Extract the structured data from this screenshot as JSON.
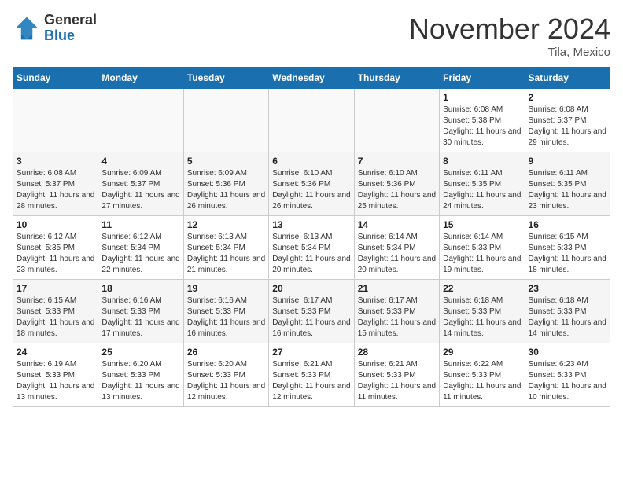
{
  "header": {
    "logo_general": "General",
    "logo_blue": "Blue",
    "month_title": "November 2024",
    "location": "Tila, Mexico"
  },
  "weekdays": [
    "Sunday",
    "Monday",
    "Tuesday",
    "Wednesday",
    "Thursday",
    "Friday",
    "Saturday"
  ],
  "weeks": [
    [
      {
        "day": "",
        "info": ""
      },
      {
        "day": "",
        "info": ""
      },
      {
        "day": "",
        "info": ""
      },
      {
        "day": "",
        "info": ""
      },
      {
        "day": "",
        "info": ""
      },
      {
        "day": "1",
        "info": "Sunrise: 6:08 AM\nSunset: 5:38 PM\nDaylight: 11 hours and 30 minutes."
      },
      {
        "day": "2",
        "info": "Sunrise: 6:08 AM\nSunset: 5:37 PM\nDaylight: 11 hours and 29 minutes."
      }
    ],
    [
      {
        "day": "3",
        "info": "Sunrise: 6:08 AM\nSunset: 5:37 PM\nDaylight: 11 hours and 28 minutes."
      },
      {
        "day": "4",
        "info": "Sunrise: 6:09 AM\nSunset: 5:37 PM\nDaylight: 11 hours and 27 minutes."
      },
      {
        "day": "5",
        "info": "Sunrise: 6:09 AM\nSunset: 5:36 PM\nDaylight: 11 hours and 26 minutes."
      },
      {
        "day": "6",
        "info": "Sunrise: 6:10 AM\nSunset: 5:36 PM\nDaylight: 11 hours and 26 minutes."
      },
      {
        "day": "7",
        "info": "Sunrise: 6:10 AM\nSunset: 5:36 PM\nDaylight: 11 hours and 25 minutes."
      },
      {
        "day": "8",
        "info": "Sunrise: 6:11 AM\nSunset: 5:35 PM\nDaylight: 11 hours and 24 minutes."
      },
      {
        "day": "9",
        "info": "Sunrise: 6:11 AM\nSunset: 5:35 PM\nDaylight: 11 hours and 23 minutes."
      }
    ],
    [
      {
        "day": "10",
        "info": "Sunrise: 6:12 AM\nSunset: 5:35 PM\nDaylight: 11 hours and 23 minutes."
      },
      {
        "day": "11",
        "info": "Sunrise: 6:12 AM\nSunset: 5:34 PM\nDaylight: 11 hours and 22 minutes."
      },
      {
        "day": "12",
        "info": "Sunrise: 6:13 AM\nSunset: 5:34 PM\nDaylight: 11 hours and 21 minutes."
      },
      {
        "day": "13",
        "info": "Sunrise: 6:13 AM\nSunset: 5:34 PM\nDaylight: 11 hours and 20 minutes."
      },
      {
        "day": "14",
        "info": "Sunrise: 6:14 AM\nSunset: 5:34 PM\nDaylight: 11 hours and 20 minutes."
      },
      {
        "day": "15",
        "info": "Sunrise: 6:14 AM\nSunset: 5:33 PM\nDaylight: 11 hours and 19 minutes."
      },
      {
        "day": "16",
        "info": "Sunrise: 6:15 AM\nSunset: 5:33 PM\nDaylight: 11 hours and 18 minutes."
      }
    ],
    [
      {
        "day": "17",
        "info": "Sunrise: 6:15 AM\nSunset: 5:33 PM\nDaylight: 11 hours and 18 minutes."
      },
      {
        "day": "18",
        "info": "Sunrise: 6:16 AM\nSunset: 5:33 PM\nDaylight: 11 hours and 17 minutes."
      },
      {
        "day": "19",
        "info": "Sunrise: 6:16 AM\nSunset: 5:33 PM\nDaylight: 11 hours and 16 minutes."
      },
      {
        "day": "20",
        "info": "Sunrise: 6:17 AM\nSunset: 5:33 PM\nDaylight: 11 hours and 16 minutes."
      },
      {
        "day": "21",
        "info": "Sunrise: 6:17 AM\nSunset: 5:33 PM\nDaylight: 11 hours and 15 minutes."
      },
      {
        "day": "22",
        "info": "Sunrise: 6:18 AM\nSunset: 5:33 PM\nDaylight: 11 hours and 14 minutes."
      },
      {
        "day": "23",
        "info": "Sunrise: 6:18 AM\nSunset: 5:33 PM\nDaylight: 11 hours and 14 minutes."
      }
    ],
    [
      {
        "day": "24",
        "info": "Sunrise: 6:19 AM\nSunset: 5:33 PM\nDaylight: 11 hours and 13 minutes."
      },
      {
        "day": "25",
        "info": "Sunrise: 6:20 AM\nSunset: 5:33 PM\nDaylight: 11 hours and 13 minutes."
      },
      {
        "day": "26",
        "info": "Sunrise: 6:20 AM\nSunset: 5:33 PM\nDaylight: 11 hours and 12 minutes."
      },
      {
        "day": "27",
        "info": "Sunrise: 6:21 AM\nSunset: 5:33 PM\nDaylight: 11 hours and 12 minutes."
      },
      {
        "day": "28",
        "info": "Sunrise: 6:21 AM\nSunset: 5:33 PM\nDaylight: 11 hours and 11 minutes."
      },
      {
        "day": "29",
        "info": "Sunrise: 6:22 AM\nSunset: 5:33 PM\nDaylight: 11 hours and 11 minutes."
      },
      {
        "day": "30",
        "info": "Sunrise: 6:23 AM\nSunset: 5:33 PM\nDaylight: 11 hours and 10 minutes."
      }
    ]
  ]
}
